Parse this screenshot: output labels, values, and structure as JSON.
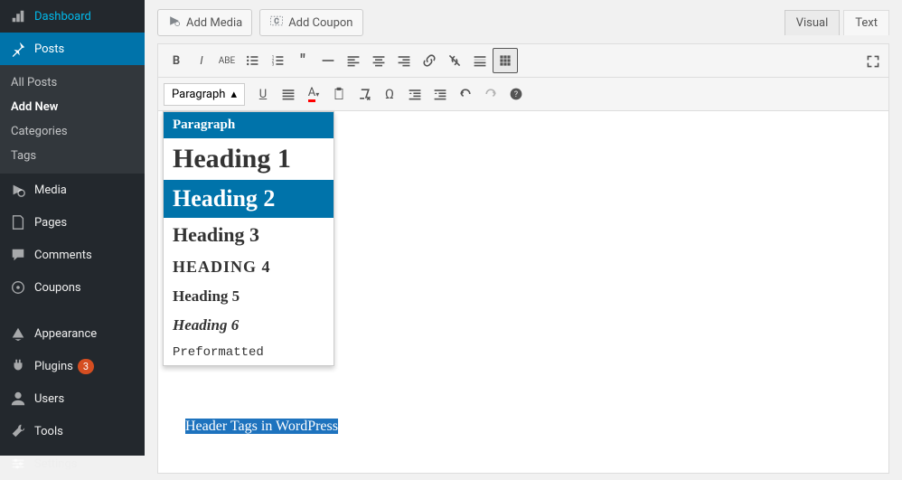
{
  "sidebar": {
    "dashboard": "Dashboard",
    "posts": "Posts",
    "posts_sub": [
      "All Posts",
      "Add New",
      "Categories",
      "Tags"
    ],
    "media": "Media",
    "pages": "Pages",
    "comments": "Comments",
    "coupons": "Coupons",
    "appearance": "Appearance",
    "plugins": "Plugins",
    "plugins_badge": "3",
    "users": "Users",
    "tools": "Tools",
    "settings": "Settings"
  },
  "toolbar": {
    "add_media": "Add Media",
    "add_coupon": "Add Coupon",
    "tab_visual": "Visual",
    "tab_text": "Text",
    "format_selected": "Paragraph"
  },
  "format_dropdown": {
    "paragraph": "Paragraph",
    "h1": "Heading 1",
    "h2": "Heading 2",
    "h3": "Heading 3",
    "h4": "Heading 4",
    "h5": "Heading 5",
    "h6": "Heading 6",
    "pre": "Preformatted"
  },
  "content": {
    "selected_text": "Header Tags in WordPress"
  }
}
